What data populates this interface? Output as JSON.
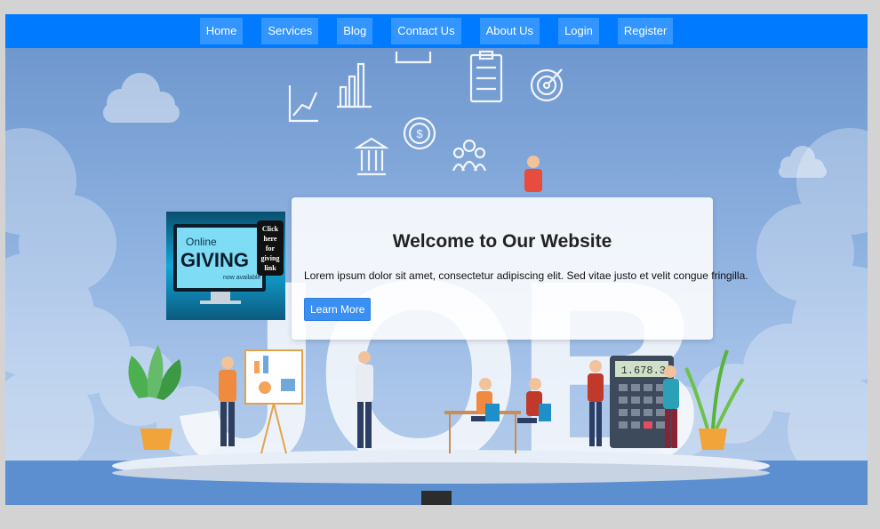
{
  "nav": {
    "items": [
      {
        "label": "Home"
      },
      {
        "label": "Services"
      },
      {
        "label": "Blog"
      },
      {
        "label": "Contact Us"
      },
      {
        "label": "About Us"
      },
      {
        "label": "Login"
      },
      {
        "label": "Register"
      }
    ]
  },
  "hero": {
    "watermark_text": "JOB",
    "giving_image": {
      "line1": "Online",
      "line2": "GIVING",
      "line3": "now available",
      "badge": [
        "Click",
        "here",
        "for",
        "giving",
        "link"
      ]
    },
    "card": {
      "title": "Welcome to Our Website",
      "text": "Lorem ipsum dolor sit amet, consectetur adipiscing elit. Sed vitae justo et velit congue fringilla.",
      "button_label": "Learn More"
    },
    "calculator_display": "1.678.3"
  },
  "colors": {
    "navbar": "#007bff",
    "button": "#3a8ff2",
    "page_background": "#d3d3d3"
  }
}
